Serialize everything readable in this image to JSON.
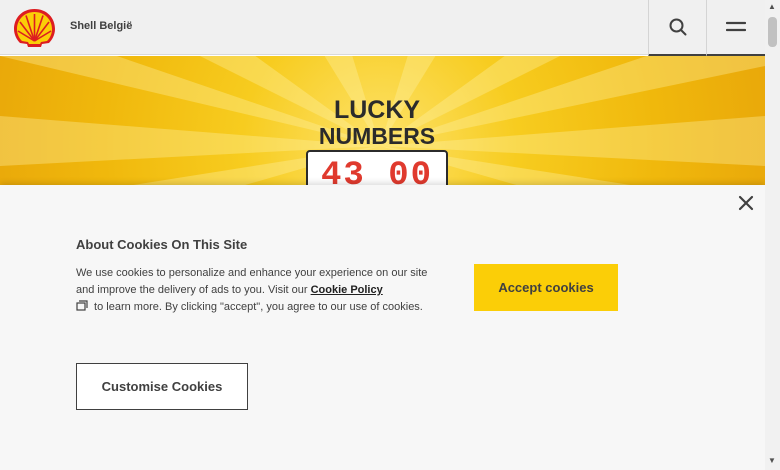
{
  "header": {
    "brand": "Shell België",
    "logo_icon": "shell-pecten-icon",
    "search_icon": "search-icon",
    "menu_icon": "hamburger-menu-icon"
  },
  "hero": {
    "line1": "LUCKY",
    "line2": "NUMBERS",
    "digits": "43 00",
    "colors": {
      "background": "#f7cc1f",
      "text": "#2b2b2b",
      "digits": "#e03a2e"
    }
  },
  "cookie_banner": {
    "title": "About Cookies On This Site",
    "text_before_link": "We use cookies to personalize and enhance your experience on our site and improve the delivery of ads to you. Visit our ",
    "link_label": "Cookie Policy",
    "text_after_link": " to learn more. By clicking \"accept\", you agree to our use of cookies.",
    "accept_label": "Accept cookies",
    "customise_label": "Customise Cookies",
    "close_icon": "close-icon",
    "colors": {
      "accept": "#fbce07",
      "panel": "#f7f7f7"
    }
  }
}
